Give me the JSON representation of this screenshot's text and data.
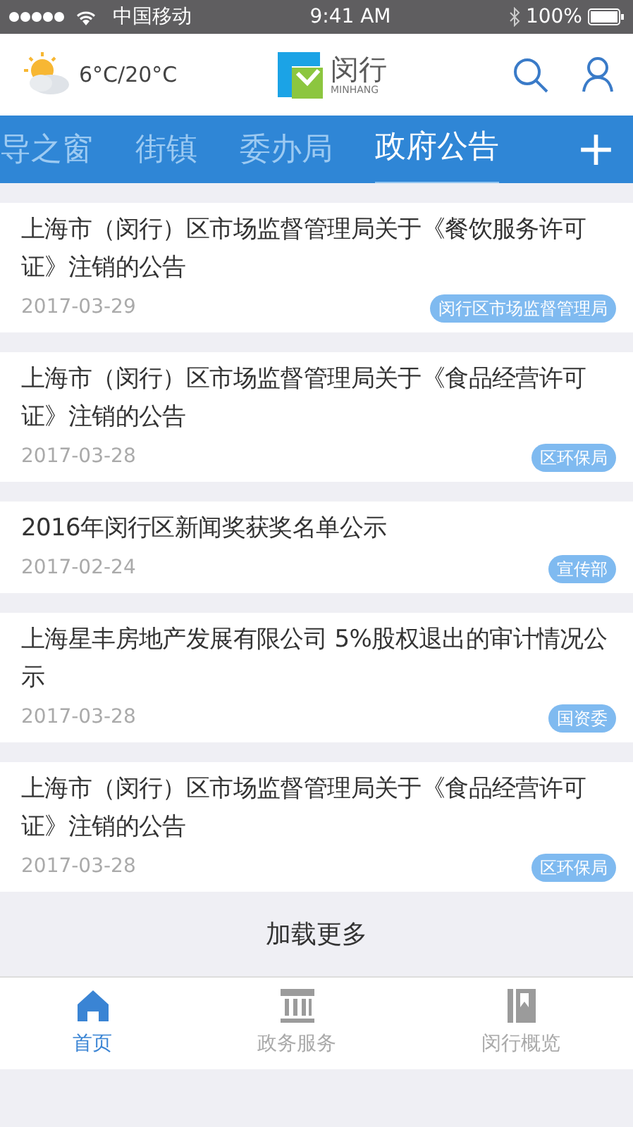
{
  "status_bar": {
    "carrier": "中国移动",
    "time": "9:41 AM",
    "battery": "100%"
  },
  "header": {
    "weather": "6°C/20°C",
    "logo_text": "闵行",
    "logo_subtext": "MINHANG"
  },
  "tabs": [
    {
      "label": "导之窗",
      "selected": false
    },
    {
      "label": "街镇",
      "selected": false
    },
    {
      "label": "委办局",
      "selected": false
    },
    {
      "label": "政府公告",
      "selected": true
    }
  ],
  "add_tab": "+",
  "articles": [
    {
      "title": "上海市（闵行）区市场监督管理局关于《餐饮服务许可证》注销的公告",
      "date": "2017-03-29",
      "tag": "闵行区市场监督管理局"
    },
    {
      "title": "上海市（闵行）区市场监督管理局关于《食品经营许可证》注销的公告",
      "date": "2017-03-28",
      "tag": "区环保局"
    },
    {
      "title": "2016年闵行区新闻奖获奖名单公示",
      "date": "2017-02-24",
      "tag": "宣传部"
    },
    {
      "title": "上海星丰房地产发展有限公司 5%股权退出的审计情况公示",
      "date": "2017-03-28",
      "tag": "国资委"
    },
    {
      "title": "上海市（闵行）区市场监督管理局关于《食品经营许可证》注销的公告",
      "date": "2017-03-28",
      "tag": "区环保局"
    }
  ],
  "load_more": "加载更多",
  "bottom_nav": [
    {
      "label": "首页",
      "kind": "home",
      "selected": true
    },
    {
      "label": "政务服务",
      "kind": "bank",
      "selected": false
    },
    {
      "label": "闵行概览",
      "kind": "books",
      "selected": false
    }
  ]
}
